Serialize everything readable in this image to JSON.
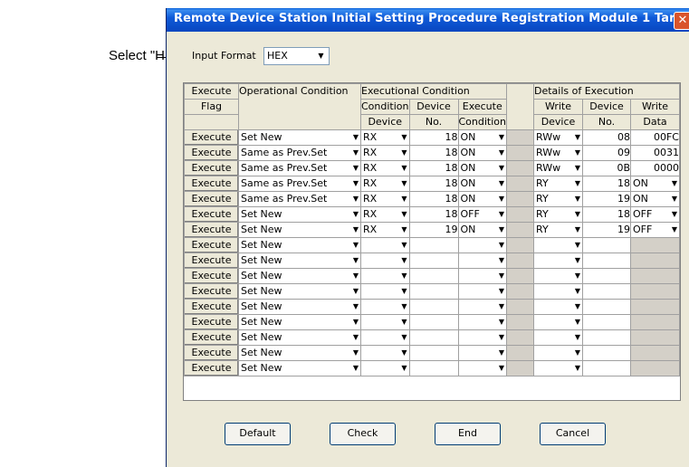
{
  "annotation": {
    "callout_text": "Select \"HEX\"."
  },
  "window": {
    "title": "Remote Device Station Initial Setting Procedure Registration Module 1 Target S...",
    "close_glyph": "✕"
  },
  "input_format": {
    "label": "Input Format",
    "value": "HEX"
  },
  "table": {
    "headers": {
      "execute_flag_1": "Execute",
      "execute_flag_2": "Flag",
      "operational_condition": "Operational Condition",
      "executional_condition": "Executional Condition",
      "condition_device_1": "Condition",
      "condition_device_2": "Device",
      "device_no_1": "Device",
      "device_no_2": "No.",
      "execute_condition_1": "Execute",
      "execute_condition_2": "Condition",
      "details_of_execution": "Details of Execution",
      "write_device_1": "Write",
      "write_device_2": "Device",
      "wdevice_no_1": "Device",
      "wdevice_no_2": "No.",
      "write_data_1": "Write",
      "write_data_2": "Data"
    },
    "rows": [
      {
        "exec": "Execute",
        "op": "Set New",
        "cdev": "RX",
        "dno": "18",
        "econd": "ON",
        "wdev": "RWw",
        "wno": "08",
        "wdata": "00FC",
        "wdata_dd": false
      },
      {
        "exec": "Execute",
        "op": "Same as Prev.Set",
        "cdev": "RX",
        "dno": "18",
        "econd": "ON",
        "wdev": "RWw",
        "wno": "09",
        "wdata": "0031",
        "wdata_dd": false
      },
      {
        "exec": "Execute",
        "op": "Same as Prev.Set",
        "cdev": "RX",
        "dno": "18",
        "econd": "ON",
        "wdev": "RWw",
        "wno": "0B",
        "wdata": "0000",
        "wdata_dd": false
      },
      {
        "exec": "Execute",
        "op": "Same as Prev.Set",
        "cdev": "RX",
        "dno": "18",
        "econd": "ON",
        "wdev": "RY",
        "wno": "18",
        "wdata": "ON",
        "wdata_dd": true
      },
      {
        "exec": "Execute",
        "op": "Same as Prev.Set",
        "cdev": "RX",
        "dno": "18",
        "econd": "ON",
        "wdev": "RY",
        "wno": "19",
        "wdata": "ON",
        "wdata_dd": true
      },
      {
        "exec": "Execute",
        "op": "Set New",
        "cdev": "RX",
        "dno": "18",
        "econd": "OFF",
        "wdev": "RY",
        "wno": "18",
        "wdata": "OFF",
        "wdata_dd": true
      },
      {
        "exec": "Execute",
        "op": "Set New",
        "cdev": "RX",
        "dno": "19",
        "econd": "ON",
        "wdev": "RY",
        "wno": "19",
        "wdata": "OFF",
        "wdata_dd": true
      },
      {
        "exec": "Execute",
        "op": "Set New",
        "cdev": "",
        "dno": "",
        "econd": "",
        "wdev": "",
        "wno": "",
        "wdata": "",
        "wdata_dd": null
      },
      {
        "exec": "Execute",
        "op": "Set New",
        "cdev": "",
        "dno": "",
        "econd": "",
        "wdev": "",
        "wno": "",
        "wdata": "",
        "wdata_dd": null
      },
      {
        "exec": "Execute",
        "op": "Set New",
        "cdev": "",
        "dno": "",
        "econd": "",
        "wdev": "",
        "wno": "",
        "wdata": "",
        "wdata_dd": null
      },
      {
        "exec": "Execute",
        "op": "Set New",
        "cdev": "",
        "dno": "",
        "econd": "",
        "wdev": "",
        "wno": "",
        "wdata": "",
        "wdata_dd": null
      },
      {
        "exec": "Execute",
        "op": "Set New",
        "cdev": "",
        "dno": "",
        "econd": "",
        "wdev": "",
        "wno": "",
        "wdata": "",
        "wdata_dd": null
      },
      {
        "exec": "Execute",
        "op": "Set New",
        "cdev": "",
        "dno": "",
        "econd": "",
        "wdev": "",
        "wno": "",
        "wdata": "",
        "wdata_dd": null
      },
      {
        "exec": "Execute",
        "op": "Set New",
        "cdev": "",
        "dno": "",
        "econd": "",
        "wdev": "",
        "wno": "",
        "wdata": "",
        "wdata_dd": null
      },
      {
        "exec": "Execute",
        "op": "Set New",
        "cdev": "",
        "dno": "",
        "econd": "",
        "wdev": "",
        "wno": "",
        "wdata": "",
        "wdata_dd": null
      },
      {
        "exec": "Execute",
        "op": "Set New",
        "cdev": "",
        "dno": "",
        "econd": "",
        "wdev": "",
        "wno": "",
        "wdata": "",
        "wdata_dd": null
      }
    ]
  },
  "buttons": {
    "default": "Default",
    "check": "Check",
    "end": "End",
    "cancel": "Cancel"
  },
  "dropdown_arrow": "▼"
}
